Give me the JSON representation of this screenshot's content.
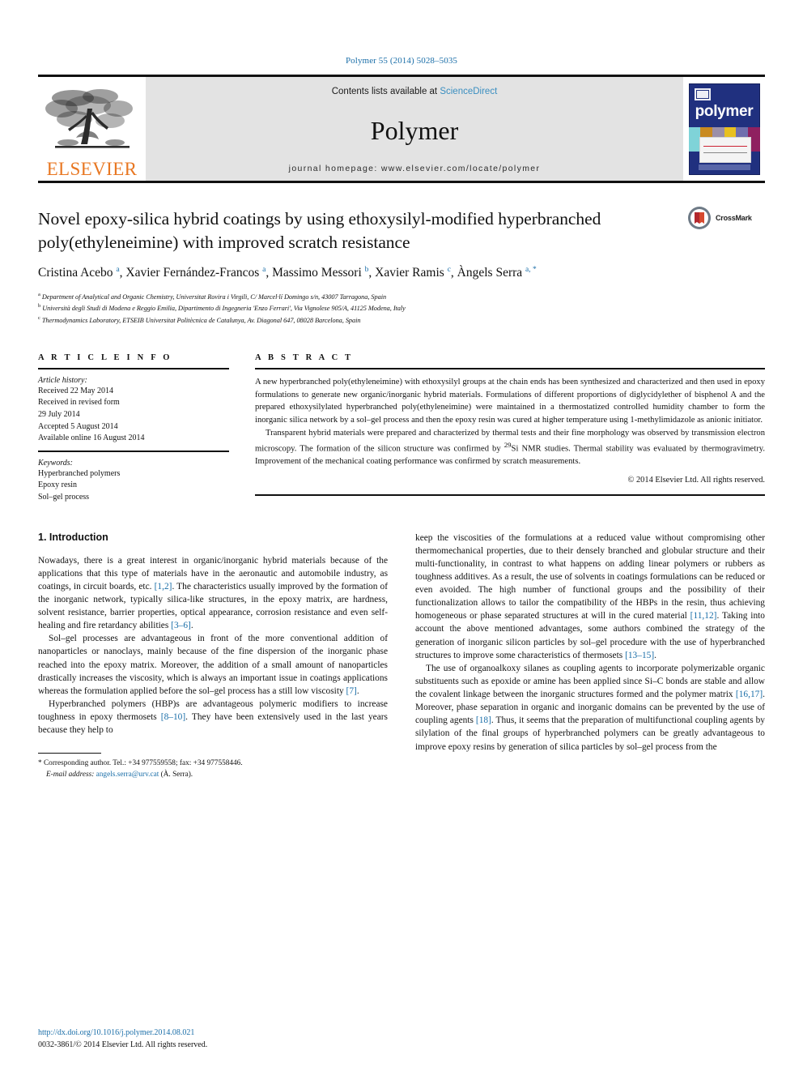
{
  "running_head": "Polymer 55 (2014) 5028–5035",
  "masthead": {
    "publisher": "ELSEVIER",
    "contents_prefix": "Contents lists available at ",
    "contents_link": "ScienceDirect",
    "journal_name": "Polymer",
    "homepage": "journal homepage: www.elsevier.com/locate/polymer",
    "cover_title": "polymer"
  },
  "article": {
    "title": "Novel epoxy-silica hybrid coatings by using ethoxysilyl-modified hyperbranched poly(ethyleneimine) with improved scratch resistance",
    "crossmark_label": "CrossMark",
    "authors_html": "Cristina Acebo <sup>a</sup>, Xavier Fernández-Francos <sup>a</sup>, Massimo Messori <sup>b</sup>, Xavier Ramis <sup>c</sup>, Àngels Serra <sup>a, *</sup>",
    "affiliations": [
      "<sup>a</sup> Department of Analytical and Organic Chemistry, Universitat Rovira i Virgili, C/ Marcel·lí Domingo s/n, 43007 Tarragona, Spain",
      "<sup>b</sup> Università degli Studi di Modena e Reggio Emilia, Dipartimento di Ingegneria 'Enzo Ferrari', Via Vignolese 905/A, 41125 Modena, Italy",
      "<sup>c</sup> Thermodynamics Laboratory, ETSEIB Universitat Politècnica de Catalunya, Av. Diagonal 647, 08028 Barcelona, Spain"
    ]
  },
  "article_info": {
    "heading": "A R T I C L E   I N F O",
    "history_label": "Article history:",
    "history": [
      "Received 22 May 2014",
      "Received in revised form",
      "29 July 2014",
      "Accepted 5 August 2014",
      "Available online 16 August 2014"
    ],
    "keywords_label": "Keywords:",
    "keywords": [
      "Hyperbranched polymers",
      "Epoxy resin",
      "Sol–gel process"
    ]
  },
  "abstract": {
    "heading": "A B S T R A C T",
    "paragraphs": [
      "A new hyperbranched poly(ethyleneimine) with ethoxysilyl groups at the chain ends has been synthesized and characterized and then used in epoxy formulations to generate new organic/inorganic hybrid materials. Formulations of different proportions of diglycidylether of bisphenol A and the prepared ethoxysilylated hyperbranched poly(ethyleneimine) were maintained in a thermostatized controlled humidity chamber to form the inorganic silica network by a sol–gel process and then the epoxy resin was cured at higher temperature using 1-methylimidazole as anionic initiator.",
      "Transparent hybrid materials were prepared and characterized by thermal tests and their fine morphology was observed by transmission electron microscopy. The formation of the silicon structure was confirmed by <sup>29</sup>Si NMR studies. Thermal stability was evaluated by thermogravimetry. Improvement of the mechanical coating performance was confirmed by scratch measurements."
    ],
    "copyright": "© 2014 Elsevier Ltd. All rights reserved."
  },
  "body": {
    "section_heading": "1. Introduction",
    "left_paragraphs": [
      "Nowadays, there is a great interest in organic/inorganic hybrid materials because of the applications that this type of materials have in the aeronautic and automobile industry, as coatings, in circuit boards, etc. <span class=\"ref\">[1,2]</span>. The characteristics usually improved by the formation of the inorganic network, typically silica-like structures, in the epoxy matrix, are hardness, solvent resistance, barrier properties, optical appearance, corrosion resistance and even self-healing and fire retardancy abilities <span class=\"ref\">[3–6]</span>.",
      "Sol–gel processes are advantageous in front of the more conventional addition of nanoparticles or nanoclays, mainly because of the fine dispersion of the inorganic phase reached into the epoxy matrix. Moreover, the addition of a small amount of nanoparticles drastically increases the viscosity, which is always an important issue in coatings applications whereas the formulation applied before the sol–gel process has a still low viscosity <span class=\"ref\">[7]</span>.",
      "Hyperbranched polymers (HBP)s are advantageous polymeric modifiers to increase toughness in epoxy thermosets <span class=\"ref\">[8–10]</span>. They have been extensively used in the last years because they help to"
    ],
    "right_paragraphs": [
      "keep the viscosities of the formulations at a reduced value without compromising other thermomechanical properties, due to their densely branched and globular structure and their multi-functionality, in contrast to what happens on adding linear polymers or rubbers as toughness additives. As a result, the use of solvents in coatings formulations can be reduced or even avoided. The high number of functional groups and the possibility of their functionalization allows to tailor the compatibility of the HBPs in the resin, thus achieving homogeneous or phase separated structures at will in the cured material <span class=\"ref\">[11,12]</span>. Taking into account the above mentioned advantages, some authors combined the strategy of the generation of inorganic silicon particles by sol–gel procedure with the use of hyperbranched structures to improve some characteristics of thermosets <span class=\"ref\">[13–15]</span>.",
      "The use of organoalkoxy silanes as coupling agents to incorporate polymerizable organic substituents such as epoxide or amine has been applied since Si–C bonds are stable and allow the covalent linkage between the inorganic structures formed and the polymer matrix <span class=\"ref\">[16,17]</span>. Moreover, phase separation in organic and inorganic domains can be prevented by the use of coupling agents <span class=\"ref\">[18]</span>. Thus, it seems that the preparation of multifunctional coupling agents by silylation of the final groups of hyperbranched polymers can be greatly advantageous to improve epoxy resins by generation of silica particles by sol–gel process from the"
    ]
  },
  "footnote": {
    "corresponding": "* Corresponding author. Tel.: +34 977559558; fax: +34 977558446.",
    "email_label": "E-mail address:",
    "email": "angels.serra@urv.cat",
    "email_suffix": "(À. Serra)."
  },
  "bottom": {
    "doi": "http://dx.doi.org/10.1016/j.polymer.2014.08.021",
    "issn": "0032-3861/© 2014 Elsevier Ltd. All rights reserved."
  },
  "colors": {
    "link": "#1a6ea8",
    "elsevier_orange": "#E87722",
    "cover_blue": "#20307f"
  }
}
